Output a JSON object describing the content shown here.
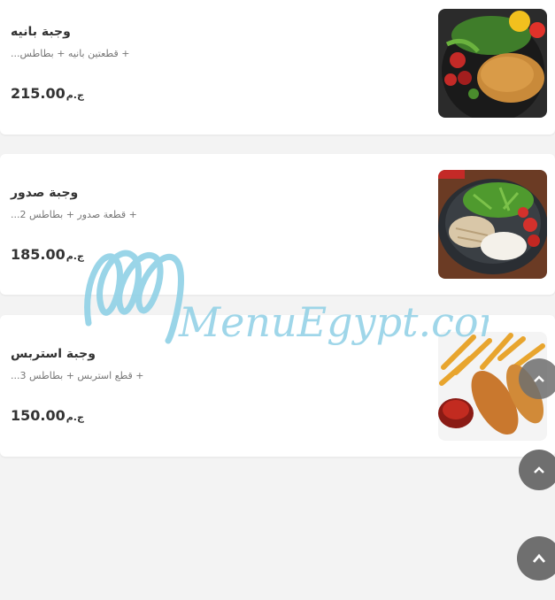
{
  "currency": "ج.م",
  "items": [
    {
      "title": "وجبة بانيه",
      "desc": "+ قطعتين بانيه + بطاطس...",
      "price": "215.00",
      "image_icon": "chicken-panne-plate-image"
    },
    {
      "title": "وجبة صدور",
      "desc": "+ قطعة صدور + بطاطس 2...",
      "price": "185.00",
      "image_icon": "grilled-chicken-rice-bowl-image"
    },
    {
      "title": "وجبة استربس",
      "desc": "+ قطع استربس + بطاطس 3...",
      "price": "150.00",
      "image_icon": "chicken-strips-fries-image"
    }
  ],
  "watermark": "MenuEgypt.com",
  "colors": {
    "background": "#f3f3f3",
    "card": "#ffffff",
    "watermark": "#8fd0e6",
    "scroll_button": "#6f6f6f"
  },
  "scroll_top_icon": "chevron-up-icon"
}
